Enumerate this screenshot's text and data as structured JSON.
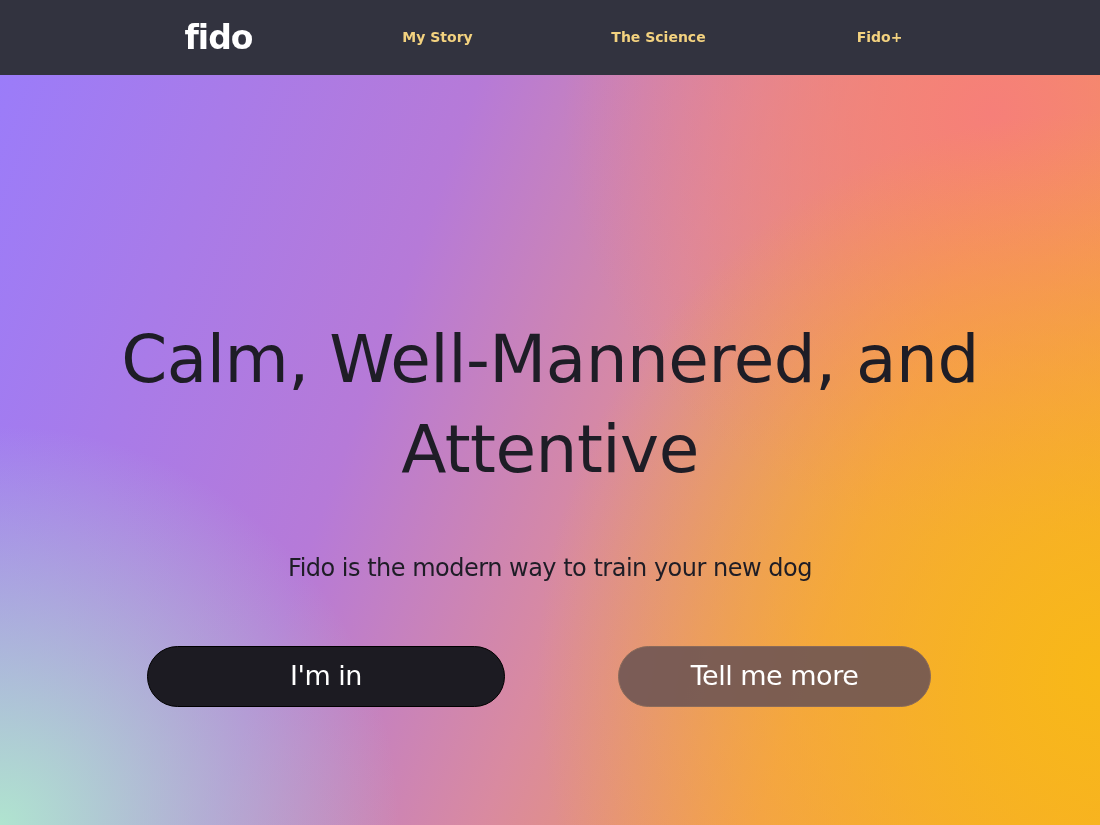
{
  "header": {
    "logo": "fido",
    "links": [
      "My Story",
      "The Science",
      "Fido+"
    ]
  },
  "hero": {
    "title": "Calm, Well-Mannered, and Attentive",
    "subtitle": "Fido is the modern way to train your new dog"
  },
  "buttons": [
    {
      "label": "I'm in",
      "kind": "primary"
    },
    {
      "label": "Tell me more",
      "kind": "secondary"
    }
  ]
}
